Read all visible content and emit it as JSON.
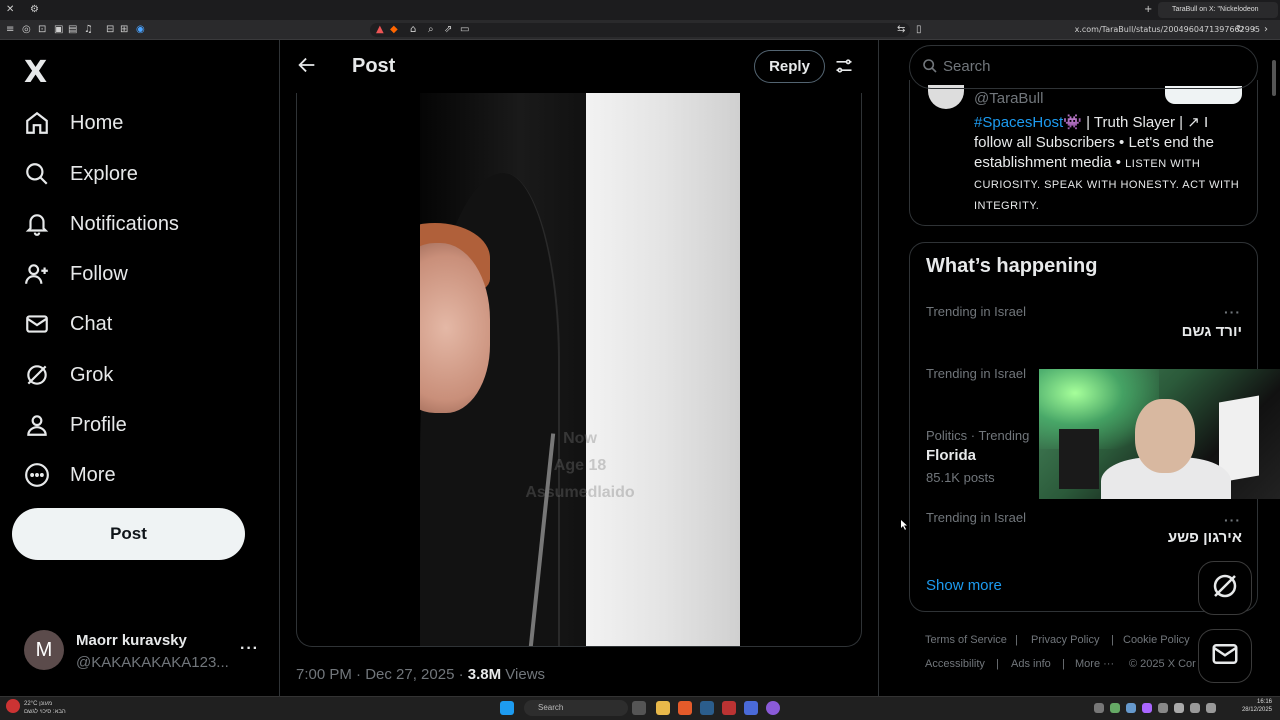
{
  "browser": {
    "url": "x.com/TaraBull/status/2004960471397662995",
    "active_tab_title": "TaraBull on X: \"Nickelodeon"
  },
  "sidebar": {
    "logo": "X",
    "items": [
      {
        "label": "Home",
        "icon": "home-icon"
      },
      {
        "label": "Explore",
        "icon": "search-icon"
      },
      {
        "label": "Notifications",
        "icon": "bell-icon"
      },
      {
        "label": "Follow",
        "icon": "person-add-icon"
      },
      {
        "label": "Chat",
        "icon": "envelope-icon"
      },
      {
        "label": "Grok",
        "icon": "grok-icon"
      },
      {
        "label": "Profile",
        "icon": "person-icon"
      },
      {
        "label": "More",
        "icon": "more-circle-icon"
      }
    ],
    "post_label": "Post",
    "account": {
      "avatar_letter": "M",
      "name": "Maorr kuravsky",
      "handle": "@KAKAKAKAKA123..."
    }
  },
  "main": {
    "title": "Post",
    "reply_label": "Reply",
    "video_captions": [
      "Now",
      "Age 18",
      "Assumedlaido"
    ],
    "time": "7:00 PM · Dec 27, 2025 ·",
    "views_count": "3.8M",
    "views_label": "Views"
  },
  "right": {
    "search_placeholder": "Search",
    "profile_card": {
      "handle": "@TaraBull",
      "bio_tag": "#SpacesHost",
      "bio_text": "| Truth Slayer | ↗ I follow all Subscribers • Let's end the establishment media •",
      "bio_smallcaps": "LISTEN WITH CURIOSITY. SPEAK WITH HONESTY. ACT WITH INTEGRITY."
    },
    "happening": {
      "title": "What’s happening",
      "trends": [
        {
          "context": "Trending in Israel",
          "name": "יורד גשם",
          "count": ""
        },
        {
          "context": "Trending in Israel",
          "name": "",
          "count": ""
        },
        {
          "context": "Politics · Trending",
          "name": "Florida",
          "count": "85.1K posts"
        },
        {
          "context": "Trending in Israel",
          "name": "אירגון פשע",
          "count": ""
        }
      ],
      "show_more": "Show more"
    },
    "footer": [
      "Terms of Service",
      "Privacy Policy",
      "Cookie Policy",
      "Accessibility",
      "Ads info",
      "More ···",
      "© 2025 X Cor"
    ]
  },
  "taskbar": {
    "search_label": "Search",
    "weather_line1": "22°C מעונן",
    "weather_line2": "הבא: סיכוי לגשם",
    "clock_time": "16:16",
    "clock_date": "28/12/2025"
  },
  "colors": {
    "accent": "#1d9bf0",
    "background": "#000000",
    "border": "#2f3336",
    "muted": "#71767b"
  }
}
